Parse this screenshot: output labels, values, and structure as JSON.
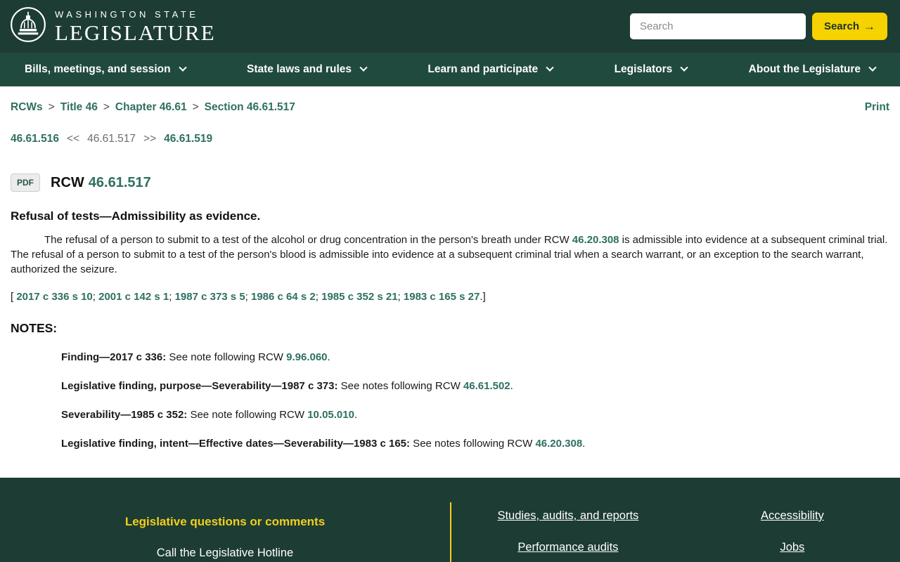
{
  "header": {
    "logo_line1": "WASHINGTON STATE",
    "logo_line2": "LEGISLATURE",
    "search_placeholder": "Search",
    "search_button_label": "Search",
    "search_arrow": "→"
  },
  "nav": {
    "items": [
      {
        "label": "Bills, meetings, and session"
      },
      {
        "label": "State laws and rules"
      },
      {
        "label": "Learn and participate"
      },
      {
        "label": "Legislators"
      },
      {
        "label": "About the Legislature"
      }
    ]
  },
  "breadcrumb": {
    "separator": ">",
    "items": [
      "RCWs",
      "Title 46",
      "Chapter 46.61",
      "Section 46.61.517"
    ],
    "print_label": "Print"
  },
  "pager": {
    "prev_link": "46.61.516",
    "prev_symbol": "<<",
    "current": "46.61.517",
    "next_symbol": ">>",
    "next_link": "46.61.519"
  },
  "section": {
    "pdf_label": "PDF",
    "rcw_label": "RCW",
    "rcw_number": "46.61.517",
    "title": "Refusal of tests—Admissibility as evidence.",
    "body_text_1": "The refusal of a person to submit to a test of the alcohol or drug concentration in the person's breath under RCW ",
    "body_link": "46.20.308",
    "body_text_2": " is admissible into evidence at a subsequent criminal trial. The refusal of a person to submit to a test of the person's blood is admissible into evidence at a subsequent criminal trial when a search warrant, or an exception to the search warrant, authorized the seizure.",
    "citation_open": "[ ",
    "citation_separator": "; ",
    "citation_close": ".]",
    "citations": [
      "2017 c 336 s 10",
      "2001 c 142 s 1",
      "1987 c 373 s 5",
      "1986 c 64 s 2",
      "1985 c 352 s 21",
      "1983 c 165 s 27"
    ],
    "notes_heading": "NOTES:",
    "notes": [
      {
        "bold": "Finding—2017 c 336:",
        "text": " See note following RCW ",
        "link": "9.96.060",
        "end": "."
      },
      {
        "bold": "Legislative finding, purpose—Severability—1987 c 373:",
        "text": " See notes following RCW ",
        "link": "46.61.502",
        "end": "."
      },
      {
        "bold": "Severability—1985 c 352:",
        "text": " See note following RCW ",
        "link": "10.05.010",
        "end": "."
      },
      {
        "bold": "Legislative finding, intent—Effective dates—Severability—1983 c 165:",
        "text": " See notes following RCW ",
        "link": "46.20.308",
        "end": "."
      }
    ]
  },
  "footer": {
    "questions_heading": "Legislative questions or comments",
    "hotline_label": "Call the Legislative Hotline",
    "links_col1": [
      "Studies, audits, and reports",
      "Performance audits"
    ],
    "links_col2": [
      "Accessibility",
      "Jobs"
    ]
  },
  "colors": {
    "header_green": "#1d3c33",
    "nav_green": "#204a3d",
    "accent_yellow": "#f6d200",
    "link_green": "#2e7061"
  }
}
